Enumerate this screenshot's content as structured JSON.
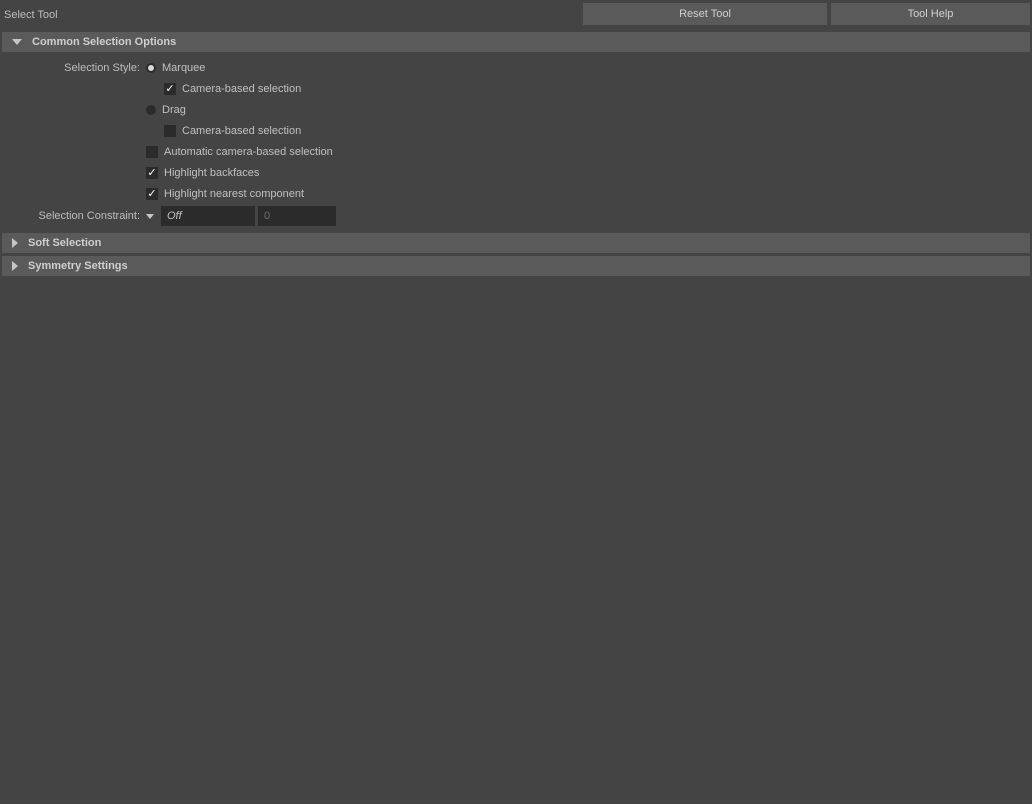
{
  "topbar": {
    "title": "Select Tool",
    "reset_button": "Reset Tool",
    "help_button": "Tool Help"
  },
  "sections": {
    "common": {
      "title": "Common Selection Options",
      "expanded": true,
      "labels": {
        "selection_style": "Selection Style:",
        "selection_constraint": "Selection Constraint:"
      },
      "options": {
        "marquee": {
          "label": "Marquee",
          "checked": true
        },
        "marquee_camera_based": {
          "label": "Camera-based selection",
          "checked": true
        },
        "drag": {
          "label": "Drag",
          "checked": false
        },
        "drag_camera_based": {
          "label": "Camera-based selection",
          "checked": false
        },
        "auto_camera_based": {
          "label": "Automatic camera-based selection",
          "checked": false
        },
        "highlight_backfaces": {
          "label": "Highlight backfaces",
          "checked": true
        },
        "highlight_nearest": {
          "label": "Highlight nearest component",
          "checked": true
        }
      },
      "constraint_select": {
        "value": "Off"
      },
      "constraint_number": {
        "value": "0"
      }
    },
    "soft": {
      "title": "Soft Selection",
      "expanded": false
    },
    "symmetry": {
      "title": "Symmetry Settings",
      "expanded": false
    }
  }
}
